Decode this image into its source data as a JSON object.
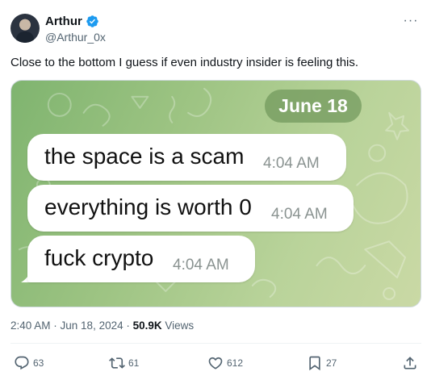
{
  "author": {
    "name": "Arthur",
    "handle": "@Arthur_0x"
  },
  "tweet": {
    "text": "Close to the bottom I guess if even industry insider is feeling this."
  },
  "media": {
    "date_chip": "June 18",
    "messages": [
      {
        "text": "the space is a scam",
        "time": "4:04 AM"
      },
      {
        "text": "everything is worth 0",
        "time": "4:04 AM"
      },
      {
        "text": "fuck crypto",
        "time": "4:04 AM"
      }
    ]
  },
  "meta": {
    "time": "2:40 AM",
    "separator1": " · ",
    "date": "Jun 18, 2024",
    "separator2": " · ",
    "views_count": "50.9K",
    "views_label": " Views"
  },
  "actions": {
    "replies": "63",
    "reposts": "61",
    "likes": "612",
    "bookmarks": "27"
  },
  "colors": {
    "verified": "#1d9bf0",
    "text_secondary": "#536471",
    "chat_bg": "#9cc382"
  }
}
